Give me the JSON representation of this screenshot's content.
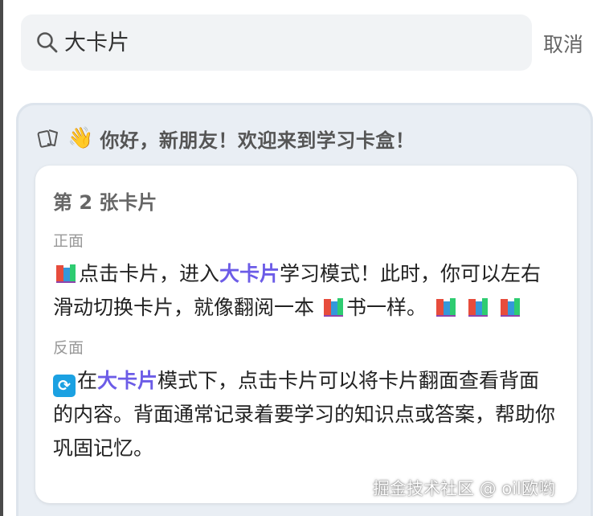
{
  "search": {
    "query": "大卡片",
    "cancel_label": "取消"
  },
  "deck": {
    "greeting": "你好，新朋友！欢迎来到学习卡盒！",
    "greeting_emoji": "👋"
  },
  "card": {
    "title": "第 2 张卡片",
    "front_label": "正面",
    "front": {
      "t1": "点击卡片，进入",
      "hl": "大卡片",
      "t2": "学习模式！此时，你可以左右滑动切换卡片，就像翻阅一本",
      "t3": "书一样。"
    },
    "back_label": "反面",
    "back": {
      "t1": "在",
      "hl": "大卡片",
      "t2": "模式下，点击卡片可以将卡片翻面查看背面的内容。背面通常记录着要学习的知识点或答案，帮助你巩固记忆。",
      "swap_glyph": "⟳"
    }
  },
  "watermark": "掘金技术社区 @ oil欧哟",
  "colors": {
    "highlight": "#6c5ce7",
    "search_bg": "#f1f3f5",
    "deck_bg": "#e9eef4",
    "swap_icon_bg": "#1ba1e2"
  },
  "icons": [
    "search-icon",
    "cards-icon",
    "wave-icon",
    "books-icon",
    "swap-icon"
  ]
}
